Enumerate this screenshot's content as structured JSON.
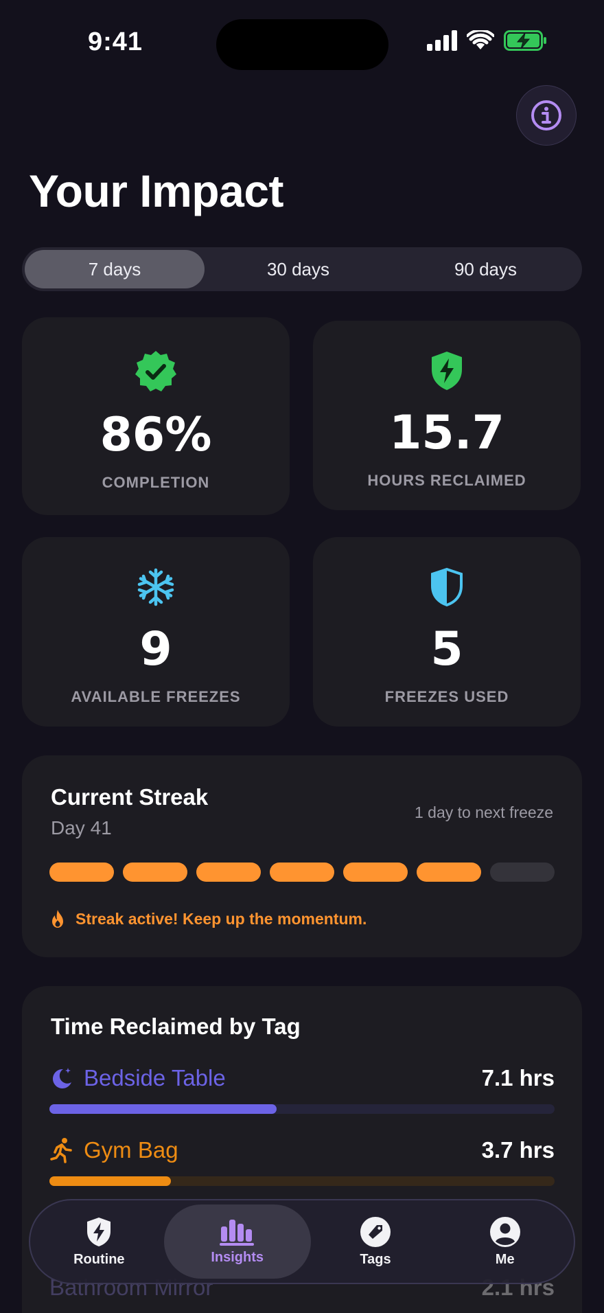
{
  "status_bar": {
    "time": "9:41"
  },
  "header": {
    "title": "Your Impact"
  },
  "range_selector": {
    "options": [
      {
        "label": "7 days",
        "selected": true
      },
      {
        "label": "30 days",
        "selected": false
      },
      {
        "label": "90 days",
        "selected": false
      }
    ]
  },
  "stats": [
    {
      "value": "86%",
      "label": "COMPLETION",
      "icon": "verified-badge-icon",
      "color": "#34c759"
    },
    {
      "value": "15.7",
      "label": "HOURS RECLAIMED",
      "icon": "lightning-shield-icon",
      "color": "#34c759"
    },
    {
      "value": "9",
      "label": "AVAILABLE FREEZES",
      "icon": "snowflake-icon",
      "color": "#4cc4f0"
    },
    {
      "value": "5",
      "label": "FREEZES USED",
      "icon": "half-shield-icon",
      "color": "#4cc4f0"
    }
  ],
  "streak": {
    "title": "Current Streak",
    "day": "Day 41",
    "next_freeze": "1 day to next freeze",
    "filled_segments": 6,
    "total_segments": 7,
    "message": "Streak active! Keep up the momentum.",
    "color": "#ff9430"
  },
  "tags": {
    "title": "Time Reclaimed by Tag",
    "items": [
      {
        "name": "Bedside Table",
        "hours": "7.1 hrs",
        "fraction": 0.45,
        "color": "#6c63e6",
        "track": "#25243a",
        "icon": "moon-stars-icon"
      },
      {
        "name": "Gym Bag",
        "hours": "3.7 hrs",
        "fraction": 0.24,
        "color": "#ee8c13",
        "track": "#35281a",
        "icon": "running-person-icon"
      }
    ],
    "partial_item": {
      "name": "Bathroom Mirror",
      "hours": "2.1 hrs"
    }
  },
  "tab_bar": {
    "items": [
      {
        "label": "Routine",
        "icon": "lightning-shield-icon",
        "active": false
      },
      {
        "label": "Insights",
        "icon": "bar-chart-icon",
        "active": true
      },
      {
        "label": "Tags",
        "icon": "tag-icon",
        "active": false
      },
      {
        "label": "Me",
        "icon": "person-icon",
        "active": false
      }
    ],
    "accent": "#b48cf2"
  }
}
